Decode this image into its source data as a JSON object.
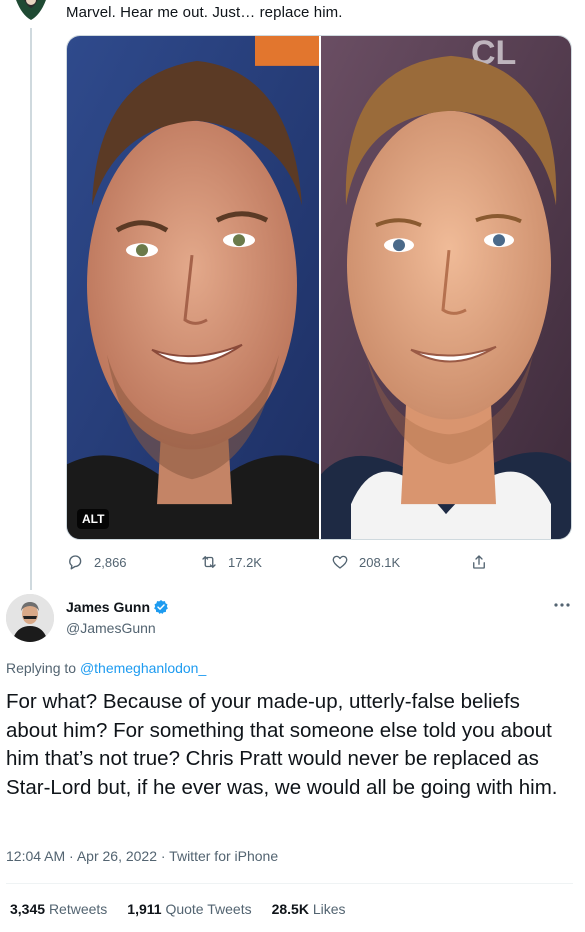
{
  "parent_tweet": {
    "text": "Marvel. Hear me out. Just… replace him.",
    "media": {
      "alt_badge": "ALT",
      "left_photo_subject": "Chris Pratt portrait",
      "right_photo_subject": "Patrick Wilson portrait"
    },
    "actions": {
      "replies": "2,866",
      "retweets": "17.2K",
      "likes": "208.1K"
    }
  },
  "main_tweet": {
    "author_name": "James Gunn",
    "author_handle": "@JamesGunn",
    "replying_prefix": "Replying to ",
    "replying_to": "@themeghanlodon_",
    "text": "For what? Because of your made-up, utterly-false beliefs about him? For something that someone else told you about him that’s not true? Chris Pratt would never be replaced as Star-Lord but, if he ever was, we would all be going with him.",
    "meta": "12:04 AM · Apr 26, 2022 · Twitter for iPhone",
    "stats": {
      "retweets_count": "3,345",
      "retweets_label": "Retweets",
      "quotes_count": "1,911",
      "quotes_label": "Quote Tweets",
      "likes_count": "28.5K",
      "likes_label": "Likes"
    }
  },
  "colors": {
    "accent": "#1d9bf0",
    "text_primary": "#0f1419",
    "text_secondary": "#536471",
    "border": "#cfd9de"
  },
  "icons": [
    "reply-icon",
    "retweet-icon",
    "like-icon",
    "share-icon",
    "verified-icon",
    "more-icon"
  ]
}
